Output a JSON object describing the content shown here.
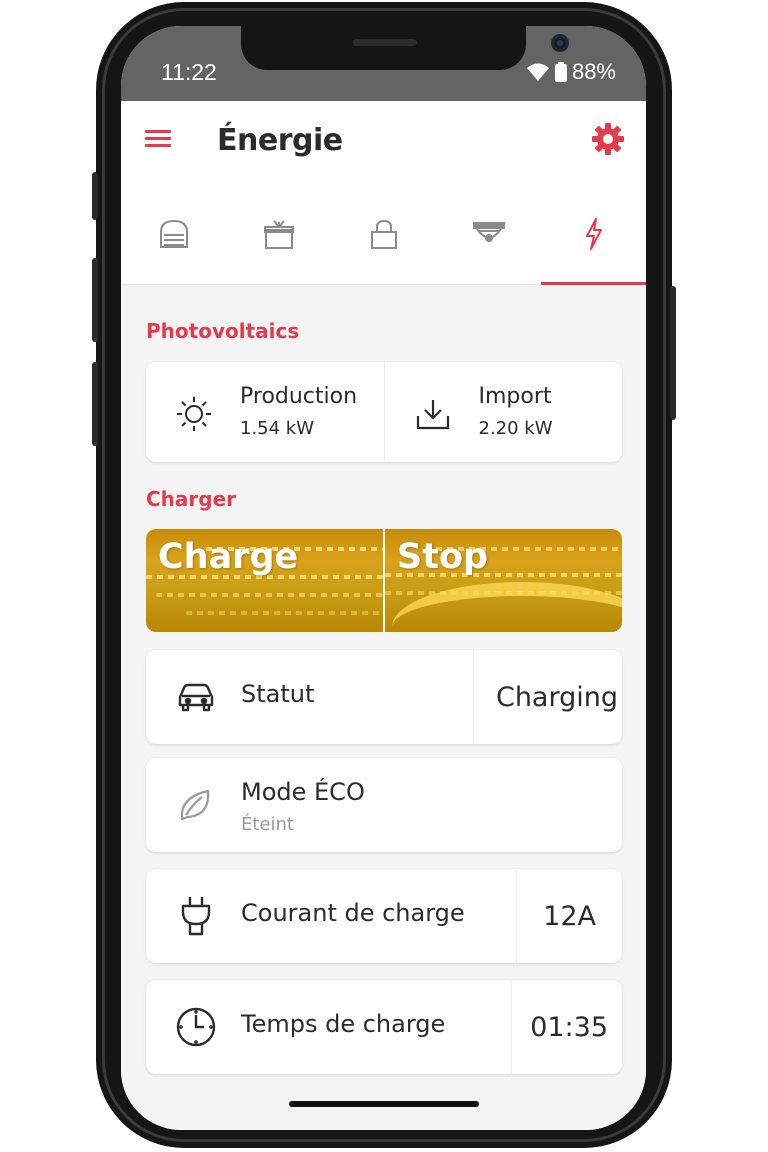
{
  "status_bar": {
    "time": "11:22",
    "battery": "88%"
  },
  "header": {
    "title": "Énergie"
  },
  "tabs": [
    {
      "icon": "garage-door-icon"
    },
    {
      "icon": "gift-box-icon"
    },
    {
      "icon": "lock-icon"
    },
    {
      "icon": "camera-dome-icon"
    },
    {
      "icon": "lightning-icon",
      "active": true
    }
  ],
  "photovoltaics": {
    "title": "Photovoltaics",
    "production": {
      "label": "Production",
      "value": "1.54 kW"
    },
    "import": {
      "label": "Import",
      "value": "2.20 kW"
    }
  },
  "charger": {
    "title": "Charger",
    "charge_label": "Charge",
    "stop_label": "Stop",
    "status": {
      "label": "Statut",
      "value": "Charging"
    },
    "eco": {
      "label": "Mode ÉCO",
      "sub": "Éteint"
    },
    "current": {
      "label": "Courant de charge",
      "value": "12A"
    },
    "time": {
      "label": "Temps de charge",
      "value": "01:35"
    }
  },
  "colors": {
    "accent": "#e43a4b",
    "statusbar": "#646464",
    "charger_gold": "#c9960f"
  }
}
